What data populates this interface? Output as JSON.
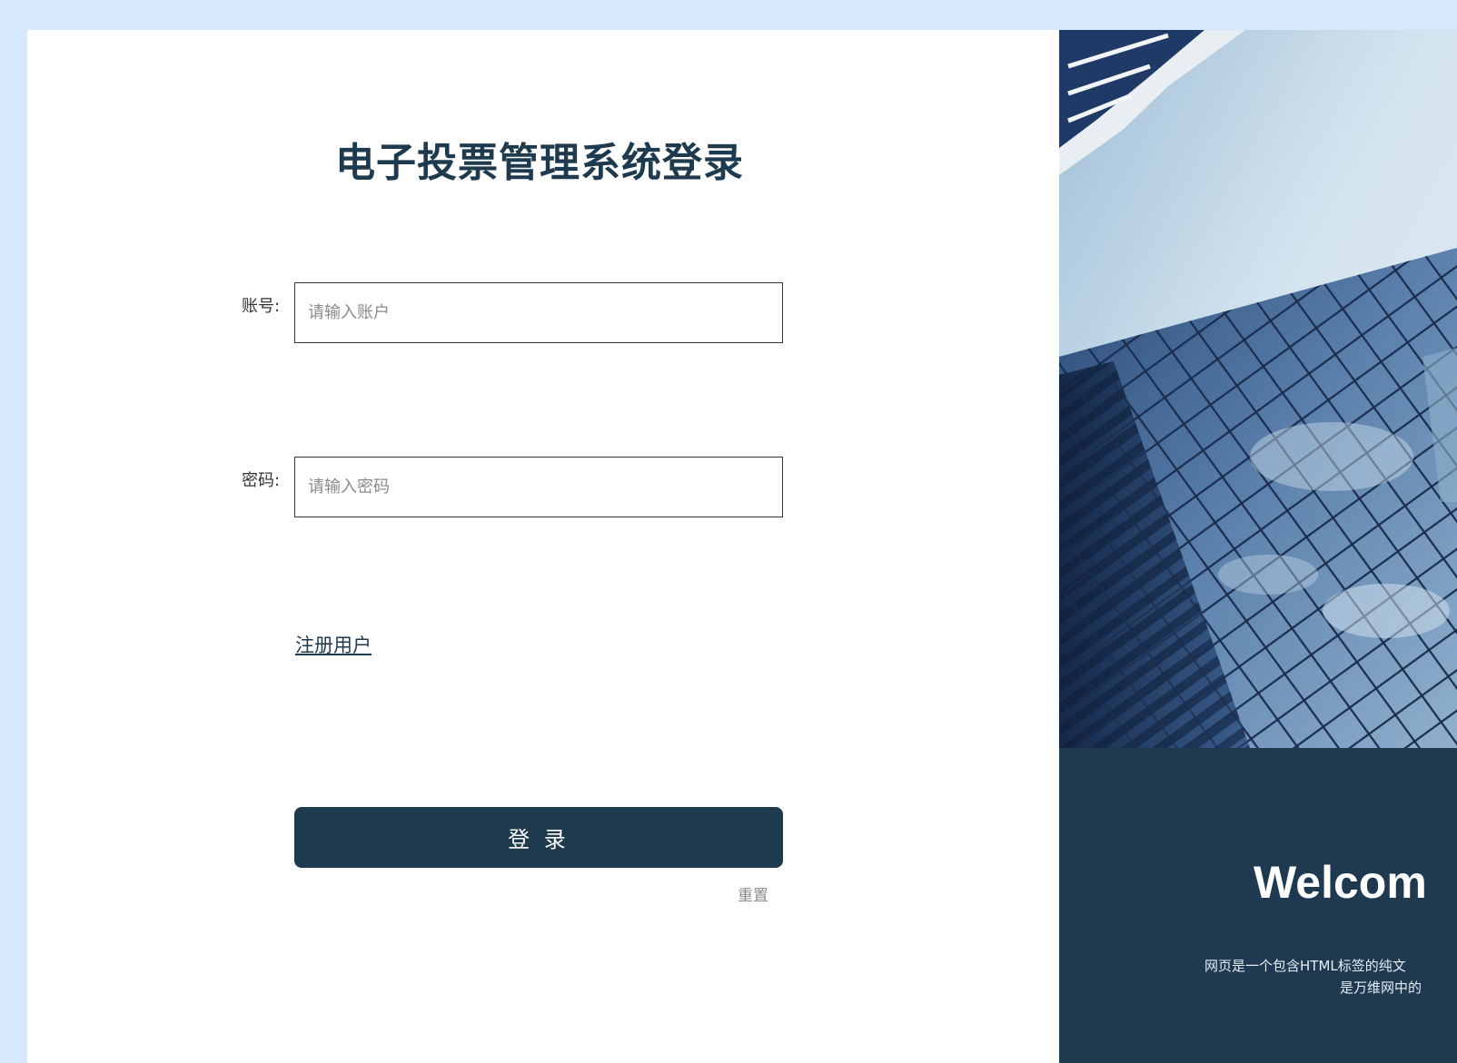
{
  "login": {
    "title": "电子投票管理系统登录",
    "account_label": "账号:",
    "account_placeholder": "请输入账户",
    "password_label": "密码:",
    "password_placeholder": "请输入密码",
    "register_link": "注册用户",
    "login_button": "登 录",
    "reset_button": "重置"
  },
  "hero": {
    "welcome_text": "Welcom",
    "description_line1": "网页是一个包含HTML标签的纯文",
    "description_line2": "是万维网中的"
  },
  "colors": {
    "page_background": "#d6e8fc",
    "brand_dark": "#1e3a4f",
    "hero_panel": "#1f3a50"
  }
}
